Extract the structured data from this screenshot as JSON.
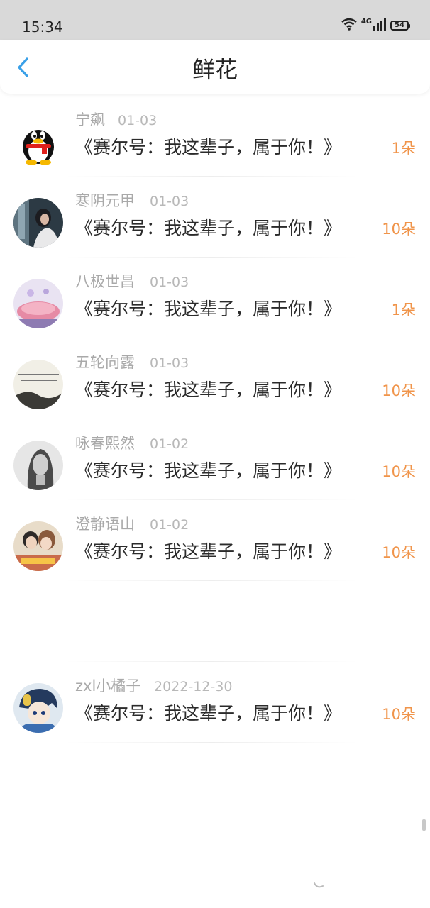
{
  "status": {
    "time": "15:34",
    "network": "4G",
    "battery": "54",
    "icons": [
      "wifi-icon",
      "signal-icon",
      "battery-icon"
    ]
  },
  "nav": {
    "title": "鲜花",
    "back_icon": "chevron-left-icon",
    "accent": "#3aa0e8"
  },
  "records": [
    {
      "name": "宁飙",
      "date": "01-03",
      "message": "《赛尔号：我这辈子，属于你！》",
      "count": "1朵",
      "avatar": "qq-penguin"
    },
    {
      "name": "寒阴元甲",
      "date": "01-03",
      "message": "《赛尔号：我这辈子，属于你！》",
      "count": "10朵",
      "avatar": "photo-girl-window"
    },
    {
      "name": "八极世昌",
      "date": "01-03",
      "message": "《赛尔号：我这辈子，属于你！》",
      "count": "1朵",
      "avatar": "photo-pink-dessert"
    },
    {
      "name": "五轮向露",
      "date": "01-03",
      "message": "《赛尔号：我这辈子，属于你！》",
      "count": "10朵",
      "avatar": "photo-text-landscape"
    },
    {
      "name": "咏春熙然",
      "date": "01-02",
      "message": "《赛尔号：我这辈子，属于你！》",
      "count": "10朵",
      "avatar": "photo-woman-bw"
    },
    {
      "name": "澄静语山",
      "date": "01-02",
      "message": "《赛尔号：我这辈子，属于你！》",
      "count": "10朵",
      "avatar": "photo-couple"
    },
    {
      "name": "zxl小橘子",
      "date": "2022-12-30",
      "message": "《赛尔号：我这辈子，属于你！》",
      "count": "10朵",
      "avatar": "anime-character"
    }
  ],
  "colors": {
    "count": "#f0944a",
    "name": "#a9a9a9",
    "message": "#2b2b2b",
    "status_bar": "#d9d9d9"
  }
}
